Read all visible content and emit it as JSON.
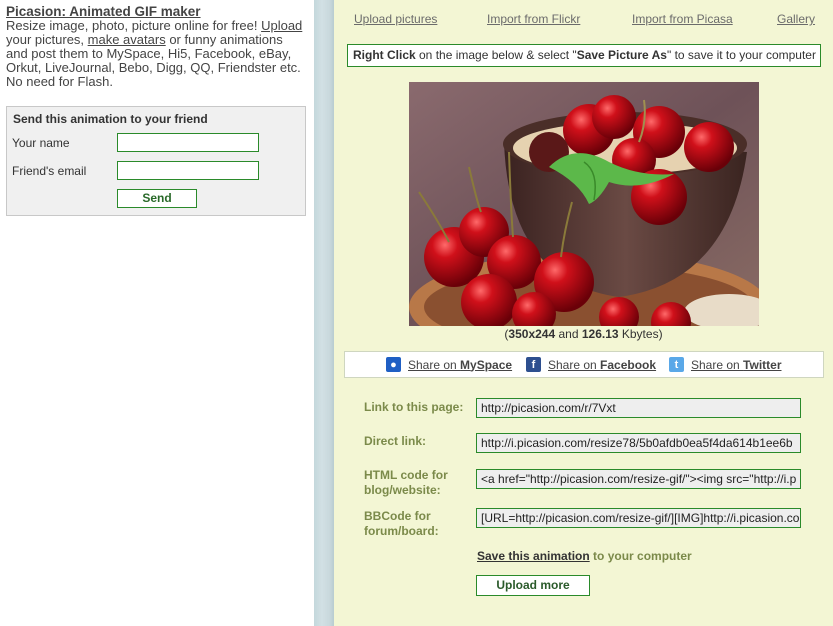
{
  "intro": {
    "title": "Picasion: Animated GIF maker",
    "text_1": "Resize image, photo, picture online for free! ",
    "link_upload": "Upload",
    "text_2": " your pictures, ",
    "link_avatars": "make avatars",
    "text_3": " or funny animations and post them to MySpace, Hi5, Facebook, eBay, Orkut, LiveJournal, Bebo, Digg, QQ, Friendster etc. No need for Flash."
  },
  "send_form": {
    "heading": "Send this animation to your friend",
    "your_name_label": "Your name",
    "your_name_value": "",
    "friend_email_label": "Friend's email",
    "friend_email_value": "",
    "send_button": "Send"
  },
  "nav": {
    "items": [
      {
        "label": "Upload pictures"
      },
      {
        "label": "Import from Flickr"
      },
      {
        "label": "Import from Picasa"
      },
      {
        "label": "Gallery"
      }
    ]
  },
  "instruction": {
    "bold_1": "Right Click",
    "text_1": " on the image below & select \"",
    "bold_2": "Save Picture As",
    "text_2": "\" to save it to your computer"
  },
  "image": {
    "alt": "Bowl of cherries with oatmeal and mint",
    "caption_open": "(",
    "dimensions": "350x244",
    "caption_and": " and ",
    "size": "126.13",
    "caption_unit": " Kbytes)"
  },
  "share": {
    "items": [
      {
        "prefix": "Share on ",
        "name": "MySpace",
        "icon": "myspace-icon",
        "color": "#1f5fc4"
      },
      {
        "prefix": "Share on ",
        "name": "Facebook",
        "icon": "facebook-icon",
        "color": "#2d4f8f"
      },
      {
        "prefix": "Share on ",
        "name": "Twitter",
        "icon": "twitter-icon",
        "color": "#5aa8e8"
      }
    ]
  },
  "links": {
    "page_label": "Link to this page:",
    "page_value": "http://picasion.com/r/7Vxt",
    "direct_label": "Direct link:",
    "direct_value": "http://i.picasion.com/resize78/5b0afdb0ea5f4da614b1ee6b",
    "html_label_1": "HTML code for",
    "html_label_2": "blog/website:",
    "html_value": "<a href=\"http://picasion.com/resize-gif/\"><img src=\"http://i.p",
    "bb_label_1": "BBCode for",
    "bb_label_2": "forum/board:",
    "bb_value": "[URL=http://picasion.com/resize-gif/][IMG]http://i.picasion.co"
  },
  "save": {
    "link": "Save this animation",
    "text": " to your computer"
  },
  "upload_more_button": "Upload more",
  "colors": {
    "accent_green": "#2a8a2a",
    "label_olive": "#7b8a4a",
    "panel_bg": "#f3f6d4"
  }
}
